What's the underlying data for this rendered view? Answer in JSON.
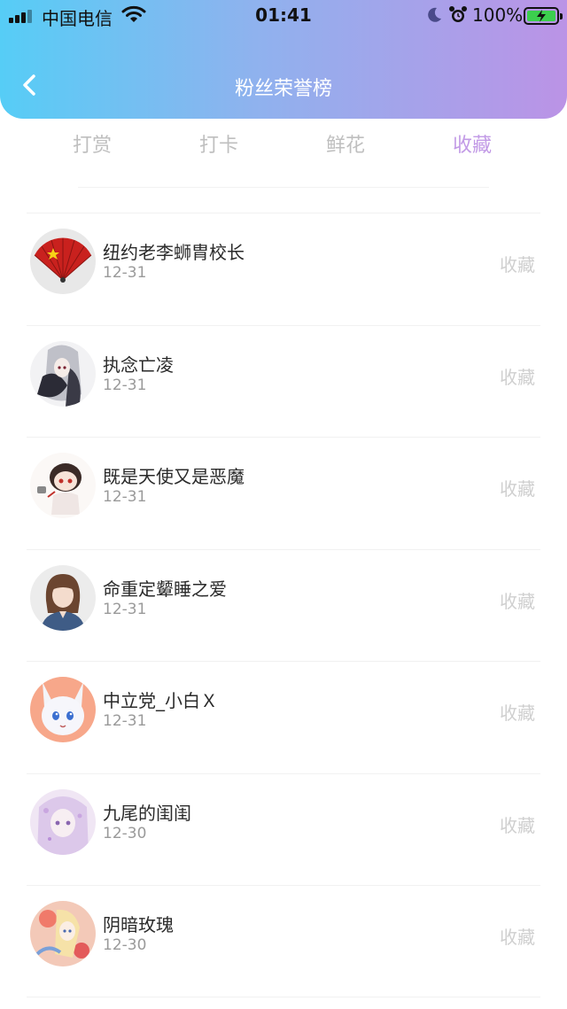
{
  "status_bar": {
    "carrier": "中国电信",
    "time": "01:41",
    "battery": "100%"
  },
  "nav": {
    "title": "粉丝荣誉榜"
  },
  "tabs": [
    {
      "label": "打赏",
      "active": false
    },
    {
      "label": "打卡",
      "active": false
    },
    {
      "label": "鲜花",
      "active": false
    },
    {
      "label": "收藏",
      "active": true
    }
  ],
  "list": [
    {
      "name": "纽约老李蛳胄校长",
      "date": "12-31",
      "action": "收藏",
      "avatar_icon": "red-fan-avatar"
    },
    {
      "name": "执念亡凌",
      "date": "12-31",
      "action": "收藏",
      "avatar_icon": "anime-dark-avatar"
    },
    {
      "name": "既是天使又是恶魔",
      "date": "12-31",
      "action": "收藏",
      "avatar_icon": "chibi-avatar"
    },
    {
      "name": "命重定颦睡之爱",
      "date": "12-31",
      "action": "收藏",
      "avatar_icon": "girl-photo-avatar"
    },
    {
      "name": "中立党_小白Ｘ",
      "date": "12-31",
      "action": "收藏",
      "avatar_icon": "white-fox-avatar"
    },
    {
      "name": "九尾的闺闺",
      "date": "12-30",
      "action": "收藏",
      "avatar_icon": "lavender-anime-avatar"
    },
    {
      "name": "阴暗玫瑰",
      "date": "12-30",
      "action": "收藏",
      "avatar_icon": "colorful-anime-avatar"
    }
  ],
  "colors": {
    "header_gradient_start": "#56cdf6",
    "header_gradient_end": "#bb93e6",
    "active_tab": "#c29ae6",
    "inactive_tab": "#bfbfbf"
  }
}
